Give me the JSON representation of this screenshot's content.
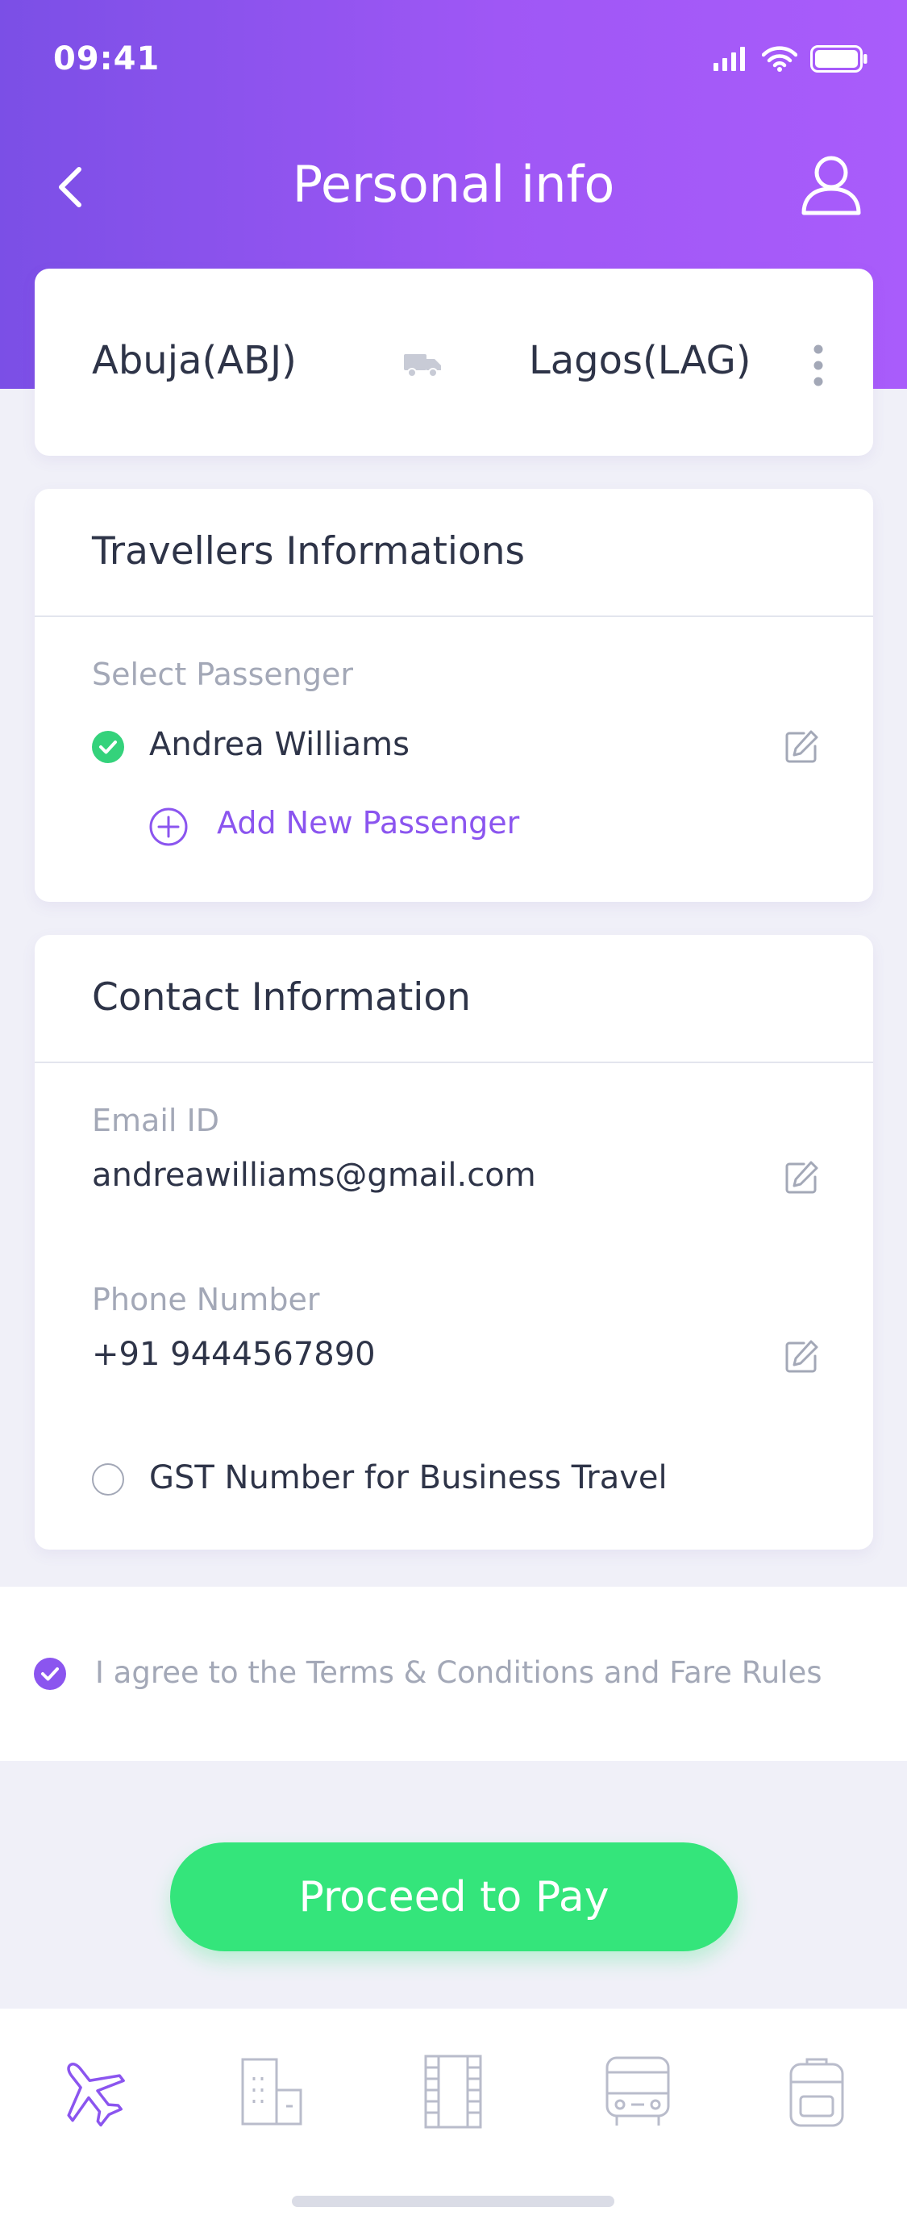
{
  "status_bar": {
    "time": "09:41"
  },
  "header": {
    "title": "Personal info"
  },
  "route": {
    "from": "Abuja(ABJ)",
    "to": "Lagos(LAG)",
    "mode_icon": "truck-icon"
  },
  "travellers": {
    "title": "Travellers Informations",
    "select_label": "Select Passenger",
    "passenger_name": "Andrea Williams",
    "add_label": "Add New Passenger"
  },
  "contact": {
    "title": "Contact Information",
    "email_label": "Email ID",
    "email_value": "andreawilliams@gmail.com",
    "phone_label": "Phone Number",
    "phone_value": "+91 9444567890",
    "gst_label": "GST Number for Business Travel"
  },
  "terms": {
    "text": "I agree to the Terms & Conditions and Fare Rules",
    "checked": true
  },
  "actions": {
    "proceed_label": "Proceed to Pay"
  },
  "tabs": [
    {
      "name": "flights",
      "icon": "airplane-icon",
      "active": true
    },
    {
      "name": "hotels",
      "icon": "building-icon",
      "active": false
    },
    {
      "name": "movies",
      "icon": "film-icon",
      "active": false
    },
    {
      "name": "bus",
      "icon": "bus-icon",
      "active": false
    },
    {
      "name": "travel-bag",
      "icon": "backpack-icon",
      "active": false
    }
  ],
  "colors": {
    "header_start": "#7B4FE6",
    "header_end": "#A95CFB",
    "accent_purple": "#8B55EF",
    "accent_green": "#34E57B",
    "text_primary": "#2E3448",
    "text_muted": "#A3A8B7"
  }
}
